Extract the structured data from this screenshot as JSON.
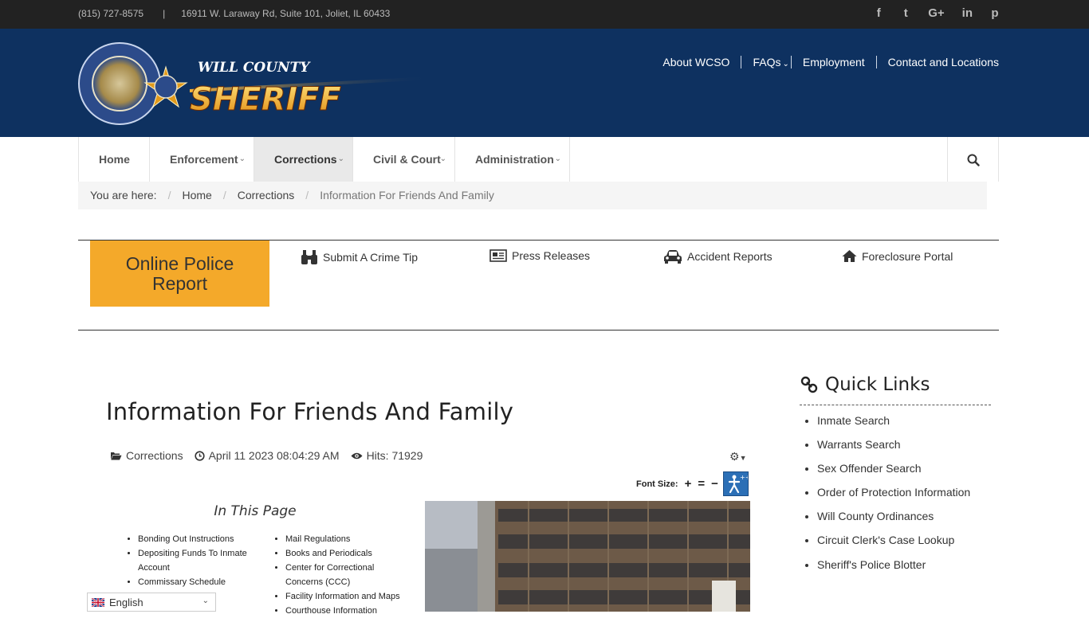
{
  "topbar": {
    "phone": "(815) 727-8575",
    "separator": "|",
    "address": "16911 W. Laraway Rd, Suite 101, Joliet, IL 60433",
    "social": [
      {
        "icon": "facebook-icon",
        "glyph": "f"
      },
      {
        "icon": "twitter-icon",
        "glyph": "t"
      },
      {
        "icon": "google-plus-icon",
        "glyph": "G+"
      },
      {
        "icon": "linkedin-icon",
        "glyph": "in"
      },
      {
        "icon": "pinterest-icon",
        "glyph": "p"
      }
    ]
  },
  "header": {
    "logo": {
      "line1": "WILL COUNTY",
      "line2": "SHERIFF",
      "seal_text": "SHERIFF'S OFFICE · WILL COUNTY"
    },
    "nav": [
      {
        "label": "About WCSO"
      },
      {
        "label": "FAQs"
      },
      {
        "label": "Employment"
      },
      {
        "label": "Contact and Locations"
      }
    ]
  },
  "mainnav": {
    "items": [
      {
        "label": "Home",
        "active": false,
        "dropdown": false
      },
      {
        "label": "Enforcement",
        "active": false,
        "dropdown": true
      },
      {
        "label": "Corrections",
        "active": true,
        "dropdown": true
      },
      {
        "label": "Civil & Court",
        "active": false,
        "dropdown": true
      },
      {
        "label": "Administration",
        "active": false,
        "dropdown": true
      }
    ],
    "search_icon": "search-icon"
  },
  "breadcrumb": {
    "prefix": "You are here:",
    "items": [
      "Home",
      "Corrections"
    ],
    "current": "Information For Friends And Family"
  },
  "quickbar": {
    "online_report": "Online Police Report",
    "links": [
      {
        "label": "Submit A Crime Tip",
        "icon": "binoculars-icon"
      },
      {
        "label": "Press Releases",
        "icon": "newspaper-icon"
      },
      {
        "label": "Accident Reports",
        "icon": "car-icon"
      },
      {
        "label": "Foreclosure Portal",
        "icon": "home-icon"
      }
    ]
  },
  "article": {
    "title": "Information For Friends And Family",
    "category": "Corrections",
    "date": "April 11 2023 08:04:29 AM",
    "hits": "Hits: 71929",
    "font_size_label": "Font Size:",
    "in_this_page": "In This Page",
    "col1": [
      "Bonding Out Instructions",
      "Depositing Funds To Inmate Account",
      "Commissary Schedule"
    ],
    "col2": [
      "Mail Regulations",
      "Books and Periodicals",
      "Center for Correctional Concerns (CCC)",
      "Facility Information and Maps",
      "Courthouse Information"
    ]
  },
  "sidebar": {
    "title": "Quick Links",
    "links": [
      "Inmate Search",
      "Warrants Search",
      "Sex Offender Search",
      "Order of Protection Information",
      "Will County Ordinances",
      "Circuit Clerk's Case Lookup",
      "Sheriff's Police Blotter"
    ]
  },
  "translate": {
    "language": "English"
  },
  "colors": {
    "header_bg": "#0e3160",
    "topbar_bg": "#222222",
    "accent": "#f4a92a"
  }
}
